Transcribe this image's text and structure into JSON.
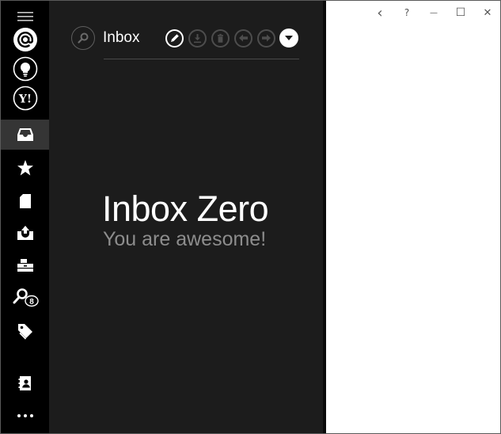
{
  "rail": {
    "items": [
      {
        "id": "menu",
        "icon": "hamburger-menu-icon"
      },
      {
        "id": "account-email",
        "icon": "email-at-account-icon"
      },
      {
        "id": "account-outlook",
        "icon": "lightbulb-account-icon"
      },
      {
        "id": "account-yahoo",
        "icon": "yahoo-account-icon",
        "glyph": "Y!"
      },
      {
        "id": "inbox",
        "icon": "inbox-tray-icon",
        "selected": true
      },
      {
        "id": "starred",
        "icon": "star-icon"
      },
      {
        "id": "drafts",
        "icon": "document-icon"
      },
      {
        "id": "sent",
        "icon": "outbox-icon"
      },
      {
        "id": "archive",
        "icon": "file-cabinet-icon"
      },
      {
        "id": "saved-search",
        "icon": "search-badge-icon",
        "badge": "8"
      },
      {
        "id": "labels",
        "icon": "tag-icon"
      },
      {
        "id": "contacts",
        "icon": "contacts-card-icon"
      },
      {
        "id": "more",
        "icon": "more-dots-icon"
      }
    ]
  },
  "header": {
    "folder_title": "Inbox"
  },
  "toolbar": {
    "buttons": [
      {
        "id": "compose",
        "icon": "pencil-icon",
        "enabled": true
      },
      {
        "id": "download",
        "icon": "download-icon",
        "enabled": false
      },
      {
        "id": "delete",
        "icon": "trash-icon",
        "enabled": false
      },
      {
        "id": "reply",
        "icon": "reply-arrow-icon",
        "enabled": false
      },
      {
        "id": "forward",
        "icon": "forward-arrow-icon",
        "enabled": false
      },
      {
        "id": "more",
        "icon": "dropdown-triangle-icon",
        "enabled": true
      }
    ]
  },
  "empty_state": {
    "title": "Inbox Zero",
    "subtitle": "You are awesome!"
  },
  "window_controls": {
    "back_glyph": "‹",
    "help_label": "?",
    "minimize_glyph": "—",
    "maximize_glyph": "☐",
    "close_glyph": "✕"
  },
  "colors": {
    "rail_bg": "#000000",
    "rail_selected": "#353535",
    "pane_bg": "#1c1c1c",
    "text_primary": "#ffffff",
    "text_secondary": "#8d8d8d",
    "disabled_icon": "#4d4d4d"
  }
}
